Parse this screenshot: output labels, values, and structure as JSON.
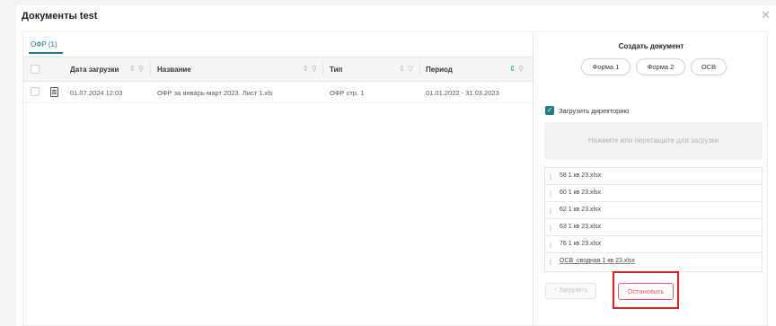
{
  "modal": {
    "title": "Документы test",
    "close": "✕"
  },
  "tabs": [
    {
      "label": "ОФР (1)",
      "active": true
    }
  ],
  "table": {
    "columns": [
      "Дата загрузки",
      "Название",
      "Тип",
      "Период"
    ],
    "rows": [
      {
        "date": "01.07.2024 12:03",
        "name": "ОФР за январь-март 2023. Лист 1.xls",
        "type": "ОФР стр. 1",
        "period": "01.01.2022 - 31.03.2023"
      }
    ]
  },
  "create": {
    "title": "Создать документ",
    "buttons": [
      "Форма 1",
      "Форма 2",
      "ОСВ"
    ]
  },
  "upload": {
    "checkbox_label": "Загрузить директорию",
    "checkbox_checked": true,
    "dropzone": "Нажмите или перетащите для загрузки",
    "files": [
      "58 1 кв 23.xlsx",
      "60 1 кв 23.xlsx",
      "62 1 кв 23.xlsx",
      "63 1 кв 23.xlsx",
      "76 1 кв 23.xlsx",
      "ОСВ_сводная 1 кв 23.xlsx"
    ],
    "upload_button": "Загрузить",
    "stop_button": "Остановить"
  },
  "colors": {
    "accent": "#1e7a85",
    "danger": "#e95d61",
    "highlight": "#e02020"
  }
}
